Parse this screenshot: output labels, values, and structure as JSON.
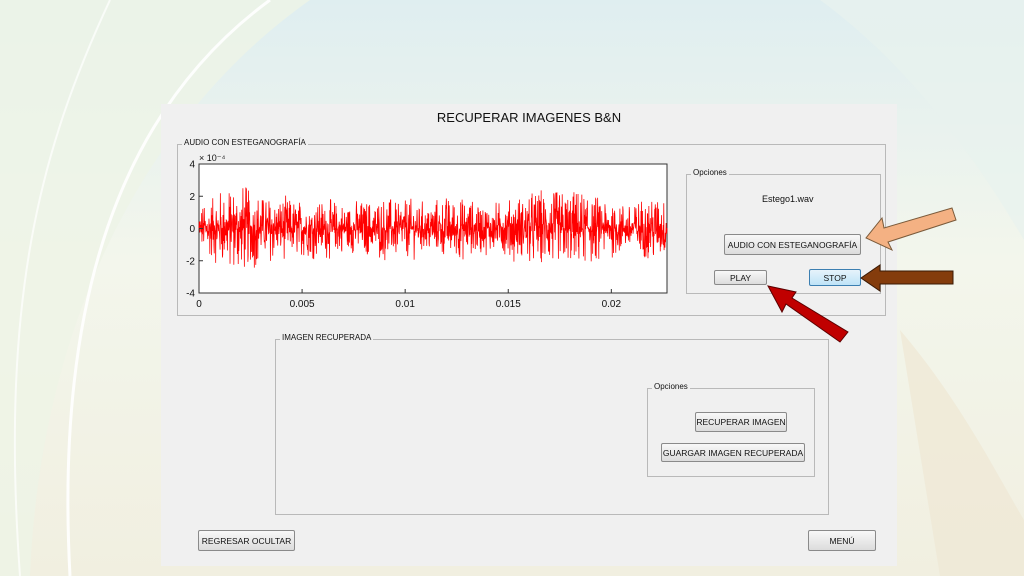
{
  "window": {
    "title": "RECUPERAR IMAGENES B&N"
  },
  "audio_panel": {
    "label": "AUDIO CON ESTEGANOGRAFÍA",
    "options": {
      "label": "Opciones",
      "file_name": "Estego1.wav",
      "audio_button": "AUDIO CON  ESTEGANOGRAFÍA",
      "play_button": "PLAY",
      "stop_button": "STOP"
    }
  },
  "image_panel": {
    "label": "IMAGEN RECUPERADA",
    "options": {
      "label": "Opciones",
      "recover_button": "RECUPERAR IMAGEN",
      "save_button": "GUARGAR IMAGEN RECUPERADA"
    }
  },
  "footer": {
    "back_button": "REGRESAR OCULTAR",
    "menu_button": "MENÚ"
  },
  "arrow_colors": {
    "audio_button_arrow": "#f4b183",
    "stop_button_arrow": "#843c0c",
    "play_button_arrow": "#c00000"
  },
  "chart_data": {
    "type": "line",
    "series_color": "#ff0000",
    "xlim": [
      0,
      0.0227
    ],
    "ylim": [
      -4,
      4
    ],
    "y_exponent": "× 10⁻⁴",
    "x_ticks": [
      "0",
      "0.005",
      "0.01",
      "0.015",
      "0.02"
    ],
    "y_ticks": [
      "4",
      "2",
      "0",
      "-2",
      "-4"
    ],
    "x_tick_values": [
      0,
      0.005,
      0.01,
      0.015,
      0.02
    ],
    "y_tick_values": [
      4,
      2,
      0,
      -2,
      -4
    ],
    "signal_envelope": [
      [
        0.0,
        1.0
      ],
      [
        0.001,
        2.0
      ],
      [
        0.002,
        2.4
      ],
      [
        0.003,
        1.8
      ],
      [
        0.004,
        1.6
      ],
      [
        0.005,
        1.4
      ],
      [
        0.006,
        1.5
      ],
      [
        0.007,
        1.3
      ],
      [
        0.008,
        1.4
      ],
      [
        0.009,
        1.6
      ],
      [
        0.01,
        1.5
      ],
      [
        0.011,
        1.3
      ],
      [
        0.012,
        1.6
      ],
      [
        0.013,
        1.5
      ],
      [
        0.014,
        1.2
      ],
      [
        0.015,
        1.4
      ],
      [
        0.016,
        1.9
      ],
      [
        0.017,
        2.1
      ],
      [
        0.018,
        2.0
      ],
      [
        0.019,
        1.8
      ],
      [
        0.02,
        1.4
      ],
      [
        0.021,
        1.3
      ],
      [
        0.022,
        1.8
      ],
      [
        0.0227,
        1.6
      ]
    ]
  }
}
